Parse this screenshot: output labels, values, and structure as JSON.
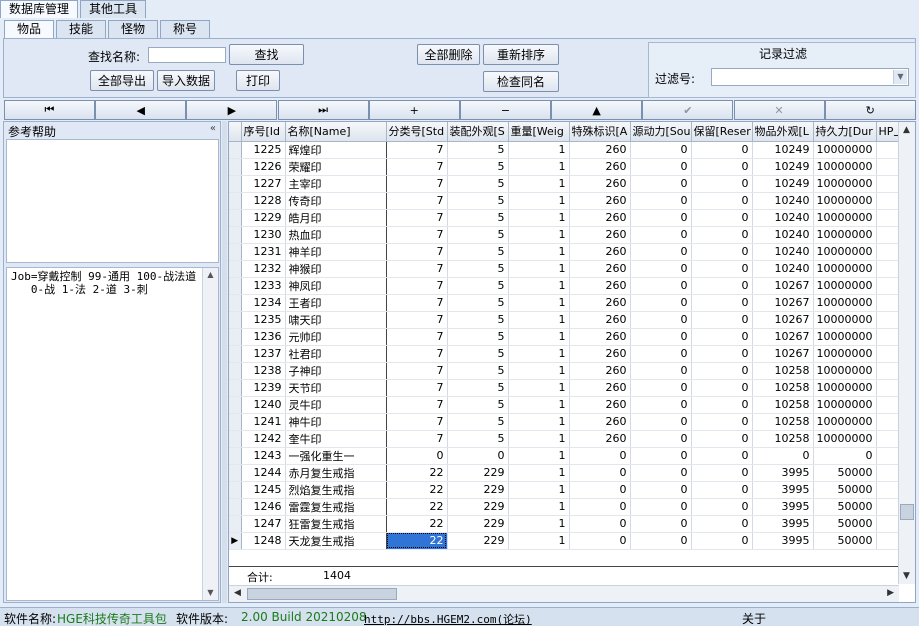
{
  "main_tabs": [
    "数据库管理",
    "其他工具"
  ],
  "sub_tabs": [
    "物品",
    "技能",
    "怪物",
    "称号"
  ],
  "search": {
    "label": "查找名称:",
    "value": "",
    "button": "查找"
  },
  "buttons": {
    "export_all": "全部导出",
    "import": "导入数据",
    "print": "打印",
    "delete_all": "全部删除",
    "resort": "重新排序",
    "check_duplicate": "检查同名"
  },
  "filter": {
    "title": "记录过滤",
    "label": "过滤号:",
    "value": ""
  },
  "nav_icons": [
    "first-icon",
    "prior-icon",
    "next-icon",
    "last-icon",
    "insert-icon",
    "delete-icon",
    "edit-icon",
    "post-icon",
    "cancel-icon",
    "refresh-icon"
  ],
  "nav_glyphs": [
    "⏮",
    "◀",
    "▶",
    "⏭",
    "+",
    "−",
    "▲",
    "✔",
    "✕",
    "↻"
  ],
  "help": {
    "title": "参考帮助",
    "collapse": "«",
    "text": "Job=穿戴控制 99-通用 100-战法道\n   0-战 1-法 2-道 3-刺"
  },
  "grid": {
    "columns": [
      "序号[Id",
      "名称[Name]",
      "分类号[Std",
      "装配外观[S",
      "重量[Weig",
      "特殊标识[A",
      "源动力[Sou",
      "保留[Reser",
      "物品外观[L",
      "持久力[Dur",
      "HP上"
    ],
    "rows": [
      [
        "1225",
        "辉煌印",
        "7",
        "5",
        "1",
        "260",
        "0",
        "0",
        "10249",
        "10000000"
      ],
      [
        "1226",
        "荣耀印",
        "7",
        "5",
        "1",
        "260",
        "0",
        "0",
        "10249",
        "10000000"
      ],
      [
        "1227",
        "主宰印",
        "7",
        "5",
        "1",
        "260",
        "0",
        "0",
        "10249",
        "10000000"
      ],
      [
        "1228",
        "传奇印",
        "7",
        "5",
        "1",
        "260",
        "0",
        "0",
        "10240",
        "10000000"
      ],
      [
        "1229",
        "皓月印",
        "7",
        "5",
        "1",
        "260",
        "0",
        "0",
        "10240",
        "10000000"
      ],
      [
        "1230",
        "热血印",
        "7",
        "5",
        "1",
        "260",
        "0",
        "0",
        "10240",
        "10000000"
      ],
      [
        "1231",
        "神羊印",
        "7",
        "5",
        "1",
        "260",
        "0",
        "0",
        "10240",
        "10000000"
      ],
      [
        "1232",
        "神猴印",
        "7",
        "5",
        "1",
        "260",
        "0",
        "0",
        "10240",
        "10000000"
      ],
      [
        "1233",
        "神凤印",
        "7",
        "5",
        "1",
        "260",
        "0",
        "0",
        "10267",
        "10000000"
      ],
      [
        "1234",
        "王者印",
        "7",
        "5",
        "1",
        "260",
        "0",
        "0",
        "10267",
        "10000000"
      ],
      [
        "1235",
        "啸天印",
        "7",
        "5",
        "1",
        "260",
        "0",
        "0",
        "10267",
        "10000000"
      ],
      [
        "1236",
        "元帅印",
        "7",
        "5",
        "1",
        "260",
        "0",
        "0",
        "10267",
        "10000000"
      ],
      [
        "1237",
        "社君印",
        "7",
        "5",
        "1",
        "260",
        "0",
        "0",
        "10267",
        "10000000"
      ],
      [
        "1238",
        "子神印",
        "7",
        "5",
        "1",
        "260",
        "0",
        "0",
        "10258",
        "10000000"
      ],
      [
        "1239",
        "天节印",
        "7",
        "5",
        "1",
        "260",
        "0",
        "0",
        "10258",
        "10000000"
      ],
      [
        "1240",
        "灵牛印",
        "7",
        "5",
        "1",
        "260",
        "0",
        "0",
        "10258",
        "10000000"
      ],
      [
        "1241",
        "神牛印",
        "7",
        "5",
        "1",
        "260",
        "0",
        "0",
        "10258",
        "10000000"
      ],
      [
        "1242",
        "奎牛印",
        "7",
        "5",
        "1",
        "260",
        "0",
        "0",
        "10258",
        "10000000"
      ],
      [
        "1243",
        "一强化重生一",
        "0",
        "0",
        "1",
        "0",
        "0",
        "0",
        "0",
        "0"
      ],
      [
        "1244",
        "赤月复生戒指",
        "22",
        "229",
        "1",
        "0",
        "0",
        "0",
        "3995",
        "50000"
      ],
      [
        "1245",
        "烈焰复生戒指",
        "22",
        "229",
        "1",
        "0",
        "0",
        "0",
        "3995",
        "50000"
      ],
      [
        "1246",
        "雷霆复生戒指",
        "22",
        "229",
        "1",
        "0",
        "0",
        "0",
        "3995",
        "50000"
      ],
      [
        "1247",
        "狂雷复生戒指",
        "22",
        "229",
        "1",
        "0",
        "0",
        "0",
        "3995",
        "50000"
      ],
      [
        "1248",
        "天龙复生戒指",
        "22",
        "229",
        "1",
        "0",
        "0",
        "0",
        "3995",
        "50000"
      ]
    ],
    "total_label": "合计:",
    "total_value": "1404"
  },
  "status": {
    "software_name_label": "软件名称:",
    "software_name": "HGE科技传奇工具包",
    "version_label": "软件版本:",
    "version": "2.00 Build 20210208",
    "forum_link": "http://bbs.HGEM2.com(论坛)",
    "about": "关于"
  },
  "colors": {
    "selection": "#3174d8",
    "status_green": "#1a7a1a",
    "background": "#e3ecf7"
  }
}
